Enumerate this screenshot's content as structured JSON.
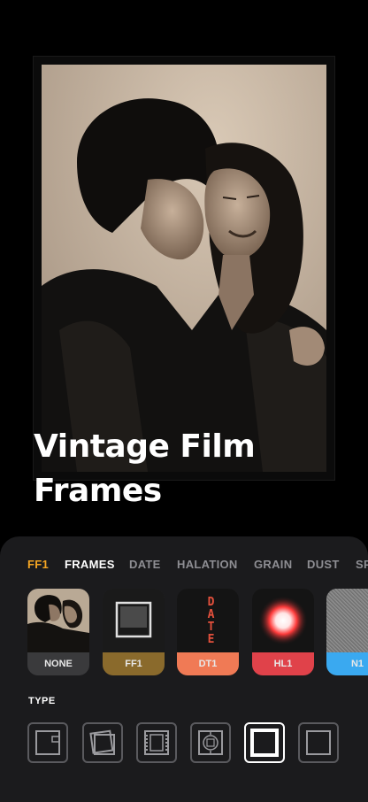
{
  "hero": {
    "headline_line1": "Vintage Film",
    "headline_line2": "Frames"
  },
  "tabs": [
    {
      "label": "FF1",
      "state": "active"
    },
    {
      "label": "FRAMES",
      "state": "selected"
    },
    {
      "label": "DATE",
      "state": "normal"
    },
    {
      "label": "HALATION",
      "state": "normal"
    },
    {
      "label": "GRAIN",
      "state": "normal"
    },
    {
      "label": "DUST",
      "state": "normal"
    },
    {
      "label": "SP",
      "state": "normal"
    }
  ],
  "presets": [
    {
      "label": "NONE",
      "color": "#3a3a3c",
      "icon": "photo-thumbnail"
    },
    {
      "label": "FF1",
      "color": "#8a6a2c",
      "icon": "polaroid-frame-icon"
    },
    {
      "label": "DT1",
      "color": "#f07a55",
      "icon": "date-stamp-icon",
      "thumb_text": "DATE"
    },
    {
      "label": "HL1",
      "color": "#e0424a",
      "icon": "halation-glow-icon"
    },
    {
      "label": "N1",
      "color": "#3aa9f0",
      "icon": "grain-noise-icon"
    }
  ],
  "type_section": {
    "label": "TYPE",
    "options": [
      {
        "icon": "instant-frame-icon",
        "selected": false
      },
      {
        "icon": "tilted-frame-icon",
        "selected": false
      },
      {
        "icon": "filmstrip-frame-icon",
        "selected": false
      },
      {
        "icon": "viewfinder-frame-icon",
        "selected": false
      },
      {
        "icon": "thick-border-frame-icon",
        "selected": true
      },
      {
        "icon": "thin-border-frame-icon",
        "selected": false
      }
    ]
  },
  "colors": {
    "accent": "#f5a623",
    "panel": "#1b1b1d"
  }
}
